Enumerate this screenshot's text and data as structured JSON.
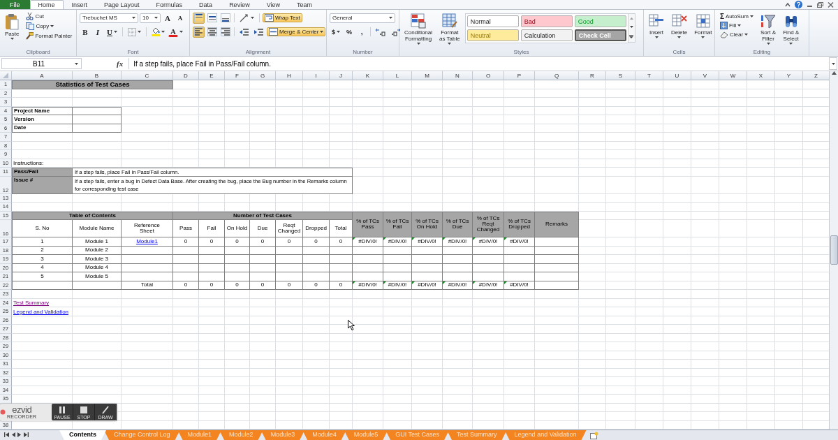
{
  "ribbon_tabs": [
    {
      "label": "File",
      "kind": "file",
      "selected": false
    },
    {
      "label": "Home",
      "kind": "tab",
      "selected": true
    },
    {
      "label": "Insert",
      "kind": "tab",
      "selected": false
    },
    {
      "label": "Page Layout",
      "kind": "tab",
      "selected": false
    },
    {
      "label": "Formulas",
      "kind": "tab",
      "selected": false
    },
    {
      "label": "Data",
      "kind": "tab",
      "selected": false
    },
    {
      "label": "Review",
      "kind": "tab",
      "selected": false
    },
    {
      "label": "View",
      "kind": "tab",
      "selected": false
    },
    {
      "label": "Team",
      "kind": "tab",
      "selected": false
    }
  ],
  "ribbon": [
    {
      "kind": "clipboard",
      "label": "Clipboard",
      "paste": "Paste",
      "cut": "Cut",
      "copy": "Copy",
      "format_painter": "Format Painter"
    },
    {
      "kind": "font",
      "label": "Font",
      "font_name": "Trebuchet MS",
      "font_size": "10",
      "grow": "A",
      "shrink": "A",
      "bold": "B",
      "italic": "I",
      "underline": "U",
      "font_color": "A"
    },
    {
      "kind": "alignment",
      "label": "Alignment",
      "vertical": [
        {
          "kind": "top",
          "on": true
        },
        {
          "kind": "middle",
          "on": false
        },
        {
          "kind": "bottom",
          "on": false
        }
      ],
      "horizontal": [
        {
          "kind": "left",
          "on": true
        },
        {
          "kind": "center",
          "on": false
        },
        {
          "kind": "right",
          "on": false
        }
      ],
      "wrap_text": {
        "label": "Wrap Text",
        "on": true
      },
      "merge_center": {
        "label": "Merge & Center",
        "on": true
      }
    },
    {
      "kind": "number",
      "label": "Number",
      "format": "General",
      "currency": "$",
      "percent": "%",
      "comma": ","
    },
    {
      "kind": "styles",
      "label": "Styles",
      "conditional": "Conditional\nFormatting",
      "format_table": "Format\nas Table",
      "styles": [
        {
          "label": "Normal",
          "color": "#ffffff"
        },
        {
          "label": "Bad",
          "color": "#ffc7ce"
        },
        {
          "label": "Good",
          "color": "#c6efce"
        },
        {
          "label": "Neutral",
          "color": "#ffeb9c"
        },
        {
          "label": "Calculation",
          "color": "#f2f2f2"
        },
        {
          "label": "Check Cell",
          "color": "#a5a5a5"
        }
      ]
    },
    {
      "kind": "cells",
      "label": "Cells",
      "buttons": [
        {
          "kind": "insert",
          "label": "Insert"
        },
        {
          "kind": "delete",
          "label": "Delete"
        },
        {
          "kind": "format",
          "label": "Format"
        }
      ]
    },
    {
      "kind": "editing",
      "label": "Editing",
      "sigma": "Σ",
      "autosum": "AutoSum",
      "fill": "Fill",
      "clear": "Clear",
      "sort": "Sort &\nFilter",
      "find": "Find &\nSelect"
    }
  ],
  "formula_bar": {
    "name_box": "B11",
    "function_label": "fx",
    "formula": "If a step fails, place Fail in Pass/Fail column."
  },
  "column_headers": [
    "A",
    "B",
    "C",
    "D",
    "E",
    "F",
    "G",
    "H",
    "I",
    "J",
    "K",
    "L",
    "M",
    "N",
    "O",
    "P",
    "Q",
    "R",
    "S",
    "T",
    "U",
    "V",
    "W",
    "X",
    "Y",
    "Z"
  ],
  "row_numbers": [
    "1",
    "2",
    "3",
    "4",
    "5",
    "6",
    "7",
    "8",
    "9",
    "10",
    "11",
    "12",
    "13",
    "14",
    "15",
    "16",
    "17",
    "18",
    "19",
    "20",
    "21",
    "22",
    "23",
    "24",
    "25",
    "26",
    "27",
    "28",
    "29",
    "30",
    "31",
    "32",
    "33",
    "34",
    "35"
  ],
  "row_numbers_below_recorder": [
    "38"
  ],
  "sheet": {
    "title": "Statistics of Test Cases",
    "project_fields": [
      "Project Name",
      "Version",
      "Date"
    ],
    "instructions_label": "Instructions:",
    "instructions": [
      {
        "term": "Pass/Fail",
        "text": "If a step fails, place Fail in Pass/Fail column."
      },
      {
        "term": "Issue #",
        "text": "If a step fails, enter a bug in Defect Data Base. After creating the bug, place the Bug number in the Remarks column for corresponding test case"
      }
    ],
    "toc": {
      "group_headers": [
        "Table of Contents",
        "Number of Test Cases"
      ],
      "columns": [
        "S. No",
        "Module Name",
        "Reference\nSheet",
        "Pass",
        "Fail",
        "On Hold",
        "Due",
        "Reqt\nChanged",
        "Dropped",
        "Total",
        "% of TCs\nPass",
        "% of TCs\nFail",
        "% of TCs\nOn Hold",
        "% of TCs\nDue",
        "% of TCs\nReqt\nChanged",
        "% of TCs\nDropped",
        "Remarks"
      ],
      "rows": [
        {
          "s_no": "1",
          "module_name": "Module 1",
          "reference_sheet": {
            "text": "Module1",
            "visited": false
          },
          "counts": [
            "0",
            "0",
            "0",
            "0",
            "0",
            "0",
            "0"
          ],
          "percentages": [
            {
              "text": "#DIV/0!",
              "flagged": true
            },
            {
              "text": "#DIV/0!",
              "flagged": true
            },
            {
              "text": "#DIV/0!",
              "flagged": true
            },
            {
              "text": "#DIV/0!",
              "flagged": true
            },
            {
              "text": "#DIV/0!",
              "flagged": true
            },
            {
              "text": "#DIV/0!",
              "flagged": true
            }
          ]
        },
        {
          "s_no": "2",
          "module_name": "Module 2"
        },
        {
          "s_no": "3",
          "module_name": "Module 3"
        },
        {
          "s_no": "4",
          "module_name": "Module 4"
        },
        {
          "s_no": "5",
          "module_name": "Module 5"
        }
      ],
      "total": {
        "label": "Total",
        "counts": [
          "0",
          "0",
          "0",
          "0",
          "0",
          "0",
          "0"
        ],
        "percentages": [
          {
            "text": "#DIV/0!",
            "flagged": true
          },
          {
            "text": "#DIV/0!",
            "flagged": true
          },
          {
            "text": "#DIV/0!",
            "flagged": true
          },
          {
            "text": "#DIV/0!",
            "flagged": true
          },
          {
            "text": "#DIV/0!",
            "flagged": true
          },
          {
            "text": "#DIV/0!",
            "flagged": true
          }
        ]
      }
    },
    "links": [
      {
        "text": "Test Summary",
        "visited": true
      },
      {
        "text": "Legend and Validation",
        "visited": false
      }
    ]
  },
  "sheet_tabs": [
    {
      "label": "Contents",
      "selected": true
    },
    {
      "label": "Change Control Log",
      "selected": false
    },
    {
      "label": "Module1",
      "selected": false
    },
    {
      "label": "Module2",
      "selected": false
    },
    {
      "label": "Module3",
      "selected": false
    },
    {
      "label": "Module4",
      "selected": false
    },
    {
      "label": "Module5",
      "selected": false
    },
    {
      "label": "GUI Test Cases",
      "selected": false
    },
    {
      "label": "Test Summary",
      "selected": false
    },
    {
      "label": "Legend and Validation",
      "selected": false
    }
  ],
  "recorder": {
    "logo": "ezvid",
    "subtitle": "RECORDER",
    "buttons": [
      {
        "kind": "pause",
        "label": "PAUSE"
      },
      {
        "kind": "stop",
        "label": "STOP"
      },
      {
        "kind": "draw",
        "label": "DRAW"
      }
    ]
  }
}
